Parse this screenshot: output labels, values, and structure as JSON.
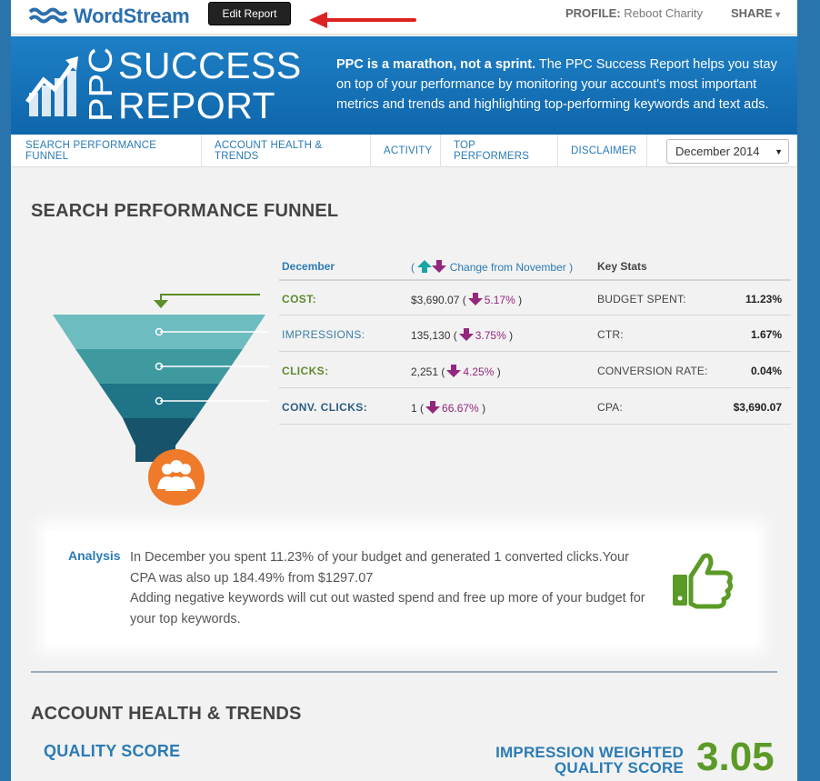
{
  "header": {
    "logo_text": "WordStream",
    "edit_button": "Edit Report",
    "profile_label": "PROFILE:",
    "profile_value": "Reboot Charity",
    "share_label": "SHARE",
    "share_caret": "▾"
  },
  "banner": {
    "ppc": "PPC",
    "title_line1": "SUCCESS",
    "title_line2": "REPORT",
    "desc_bold": "PPC is a marathon, not a sprint.",
    "desc_rest": " The PPC Success Report helps you stay on top of your performance by monitoring your account's most important metrics and trends and highlighting top-performing keywords and text ads."
  },
  "nav": {
    "tabs": [
      {
        "label": "SEARCH PERFORMANCE FUNNEL"
      },
      {
        "label": "ACCOUNT HEALTH & TRENDS"
      },
      {
        "label": "ACTIVITY"
      },
      {
        "label": "TOP PERFORMERS"
      },
      {
        "label": "DISCLAIMER"
      }
    ],
    "month_select": "December 2014",
    "month_caret": "▼"
  },
  "funnel_section": {
    "title": "SEARCH PERFORMANCE FUNNEL",
    "table_header": {
      "period": "December",
      "paren_open": "(",
      "change": "Change from November )",
      "key_stats": "Key Stats"
    },
    "rows": [
      {
        "metric": "COST:",
        "value": "$3,690.07 (",
        "change": "5.17%",
        "close": ")",
        "stat": "BUDGET SPENT:",
        "stat_value": "11.23%"
      },
      {
        "metric": "IMPRESSIONS:",
        "value": "135,130 (",
        "change": "3.75%",
        "close": ")",
        "stat": "CTR:",
        "stat_value": "1.67%"
      },
      {
        "metric": "CLICKS:",
        "value": "2,251 (",
        "change": "4.25%",
        "close": ")",
        "stat": "CONVERSION RATE:",
        "stat_value": "0.04%"
      },
      {
        "metric": "CONV. CLICKS:",
        "value": "1 (",
        "change": "66.67%",
        "close": ")",
        "stat": "CPA:",
        "stat_value": "$3,690.07"
      }
    ],
    "colors": {
      "teal_up": "#1aa3a3",
      "purple_down": "#93277d",
      "funnel_orange": "#ee7a2a"
    }
  },
  "analysis": {
    "label": "Analysis",
    "line1": "In December you spent 11.23% of your budget and generated 1 converted clicks.Your CPA was also up 184.49% from $1297.07",
    "line2": "Adding negative keywords will cut out wasted spend and free up more of your budget for your top keywords.",
    "icon": "thumbs-up-icon"
  },
  "account_health": {
    "title": "ACCOUNT HEALTH & TRENDS",
    "quality_score_label": "QUALITY SCORE",
    "iwqs_line1": "IMPRESSION WEIGHTED",
    "iwqs_line2": "QUALITY SCORE",
    "iwqs_value": "3.05"
  }
}
